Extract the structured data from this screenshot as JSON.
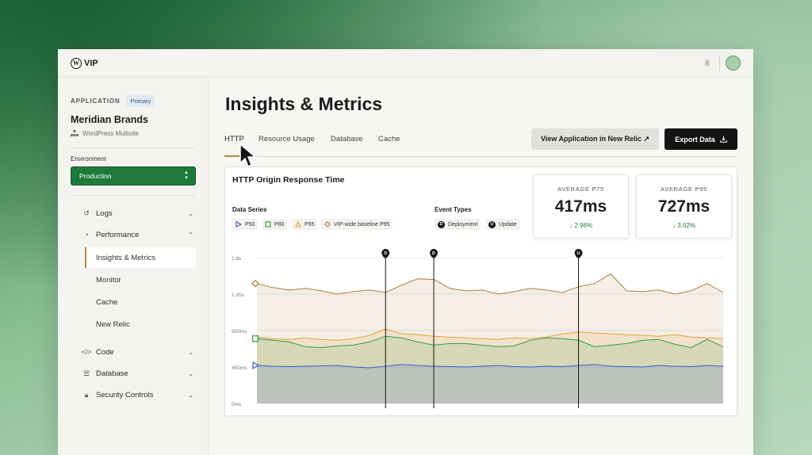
{
  "header": {
    "logo_text": "VIP",
    "logo_mark": "W"
  },
  "sidebar": {
    "application_label": "APPLICATION",
    "application_badge": "Primary",
    "app_name": "Meridian Brands",
    "app_type": "WordPress Multisite",
    "environment_label": "Environment",
    "environment_value": "Production",
    "nav": [
      {
        "label": "Logs",
        "icon": "history-icon",
        "expanded": false
      },
      {
        "label": "Performance",
        "icon": "gauge-icon",
        "expanded": true
      },
      {
        "label": "Code",
        "icon": "code-icon",
        "expanded": false
      },
      {
        "label": "Database",
        "icon": "database-icon",
        "expanded": false
      },
      {
        "label": "Security Controls",
        "icon": "lock-icon",
        "expanded": false
      }
    ],
    "performance_items": [
      "Insights & Metrics",
      "Monitor",
      "Cache",
      "New Relic"
    ],
    "active_item": "Insights & Metrics"
  },
  "main": {
    "title": "Insights & Metrics",
    "tabs": [
      "HTTP",
      "Resource Usage",
      "Database",
      "Cache"
    ],
    "active_tab": "HTTP",
    "btn_new_relic": "View Application in New Relic ↗",
    "btn_export": "Export Data"
  },
  "panel": {
    "title": "HTTP Origin Response Time",
    "data_series_label": "Data Series",
    "event_types_label": "Event Types",
    "series_chips": [
      {
        "label": "P50",
        "marker": "triangle-right",
        "color": "#3b5bdb"
      },
      {
        "label": "P80",
        "marker": "square",
        "color": "#2f9e44"
      },
      {
        "label": "P95",
        "marker": "triangle-up",
        "color": "#e0a43a"
      },
      {
        "label": "VIP-wide baseline P95",
        "marker": "diamond",
        "color": "#b07d3a"
      }
    ],
    "event_chips": [
      {
        "code": "D",
        "label": "Deployment"
      },
      {
        "code": "U",
        "label": "Update"
      }
    ],
    "stats": [
      {
        "label": "AVERAGE P75",
        "value": "417ms",
        "delta": "↓ 2.96%"
      },
      {
        "label": "AVERAGE P95",
        "value": "727ms",
        "delta": "↓ 3.02%"
      }
    ]
  },
  "chart_data": {
    "type": "area",
    "y_ticks": [
      "1.8s",
      "1.35s",
      "900ms",
      "450ms",
      "0ms"
    ],
    "ylim": [
      0,
      1800
    ],
    "x": [
      0,
      1,
      2,
      3,
      4,
      5,
      6,
      7,
      8,
      9,
      10,
      11,
      12,
      13,
      14,
      15,
      16,
      17,
      18,
      19,
      20,
      21,
      22,
      23,
      24,
      25,
      26,
      27,
      28,
      29
    ],
    "series": [
      {
        "name": "VIP-wide baseline P95",
        "color": "#b07d3a",
        "values": [
          1480,
          1430,
          1400,
          1420,
          1390,
          1350,
          1380,
          1400,
          1370,
          1460,
          1540,
          1530,
          1420,
          1390,
          1400,
          1350,
          1380,
          1420,
          1400,
          1370,
          1440,
          1480,
          1600,
          1390,
          1380,
          1400,
          1350,
          1390,
          1480,
          1370
        ]
      },
      {
        "name": "P95",
        "color": "#e0a43a",
        "values": [
          820,
          800,
          790,
          810,
          790,
          780,
          800,
          840,
          920,
          860,
          850,
          830,
          820,
          810,
          800,
          790,
          810,
          800,
          820,
          860,
          880,
          870,
          860,
          850,
          840,
          830,
          850,
          820,
          810,
          800
        ]
      },
      {
        "name": "P80",
        "color": "#2f9e44",
        "values": [
          800,
          780,
          760,
          700,
          690,
          710,
          720,
          760,
          830,
          810,
          760,
          720,
          740,
          740,
          720,
          700,
          710,
          780,
          810,
          800,
          780,
          700,
          720,
          740,
          780,
          790,
          730,
          690,
          790,
          700
        ]
      },
      {
        "name": "P50",
        "color": "#3b5bdb",
        "values": [
          470,
          460,
          455,
          460,
          465,
          470,
          450,
          440,
          460,
          480,
          470,
          460,
          455,
          450,
          460,
          470,
          455,
          450,
          460,
          455,
          470,
          480,
          460,
          455,
          450,
          470,
          460,
          455,
          470,
          460
        ]
      }
    ],
    "events": [
      {
        "code": "D",
        "x": 8
      },
      {
        "code": "D",
        "x": 11
      },
      {
        "code": "U",
        "x": 20
      }
    ],
    "grid": true
  }
}
